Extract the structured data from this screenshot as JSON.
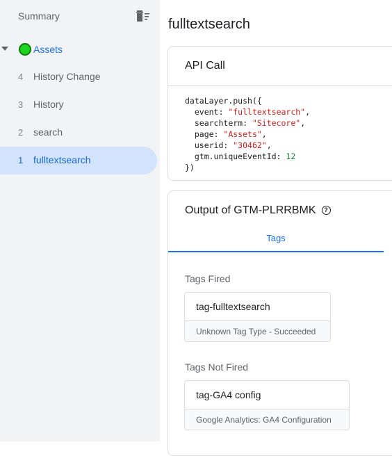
{
  "sidebar": {
    "summary_label": "Summary",
    "clear_icon": "delete-sweep-icon",
    "container": {
      "label": "Assets",
      "status_color": "#1ed41e"
    },
    "events": [
      {
        "number": "4",
        "label": "History Change"
      },
      {
        "number": "3",
        "label": "History"
      },
      {
        "number": "2",
        "label": "search"
      },
      {
        "number": "1",
        "label": "fulltextsearch",
        "selected": true
      }
    ]
  },
  "main": {
    "title": "fulltextsearch",
    "api_call": {
      "title": "API Call",
      "code": {
        "open": "dataLayer.push({",
        "event_key": "event: ",
        "event_val": "\"fulltextsearch\"",
        "searchterm_key": "searchterm: ",
        "searchterm_val": "\"Sitecore\"",
        "page_key": "page: ",
        "page_val": "\"Assets\"",
        "userid_key": "userid: ",
        "userid_val": "\"30462\"",
        "gtm_key": "gtm.uniqueEventId: ",
        "gtm_val": "12",
        "comma": ",",
        "close": "})"
      }
    },
    "output": {
      "title": "Output of GTM-PLRRBMK",
      "help_icon": "help-icon",
      "help_glyph": "?",
      "tab_label": "Tags",
      "fired_label": "Tags Fired",
      "fired": [
        {
          "name": "tag-fulltextsearch",
          "type": "Unknown Tag Type - Succeeded"
        }
      ],
      "not_fired_label": "Tags Not Fired",
      "not_fired": [
        {
          "name": "tag-GA4 config",
          "type": "Google Analytics: GA4 Configuration"
        }
      ]
    }
  },
  "colors": {
    "accent": "#1a73e8",
    "selected_bg": "#d2e3fc",
    "sidebar_bg": "#f1f3f4"
  }
}
